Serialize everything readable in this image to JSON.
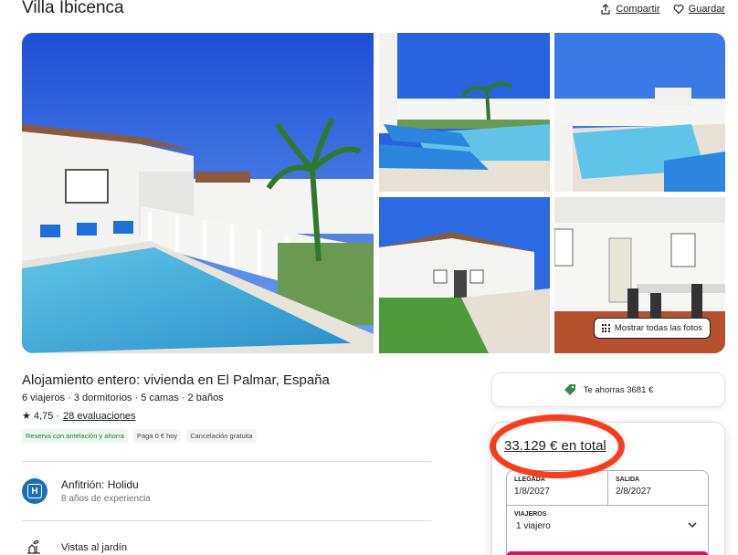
{
  "header": {
    "title": "Villa Ibicenca",
    "share_label": "Compartir",
    "save_label": "Guardar"
  },
  "gallery": {
    "show_all_label": "Mostrar todas las fotos"
  },
  "listing": {
    "subtitle": "Alojamiento entero: vivienda en El Palmar, España",
    "details": "6 viajeros · 3 dormitorios · 5 camas · 2 baños",
    "rating": "★ 4,75 ·",
    "reviews_label": "28 evaluaciones",
    "tags": [
      "Reserva con antelación y ahorra",
      "Paga 0 € hoy",
      "Cancelación gratuita"
    ]
  },
  "host": {
    "name": "Anfitrión: Holidu",
    "experience": "8 años de experiencia",
    "logo_letter": "H"
  },
  "amenity": {
    "label": "Vistas al jardín",
    "icon": "garden-icon"
  },
  "booking": {
    "savings": "Te ahorras 3681 €",
    "total": "33.129 € en total",
    "checkin_label": "LLEGADA",
    "checkin_value": "1/8/2027",
    "checkout_label": "SALIDA",
    "checkout_value": "2/8/2027",
    "guests_label": "VIAJEROS",
    "guests_value": "1 viajero"
  },
  "colors": {
    "highlight": "#ff3b1a",
    "brand": "#dd1062",
    "host_logo": "#1b6fb6",
    "savings_icon": "#2e8b4a"
  }
}
